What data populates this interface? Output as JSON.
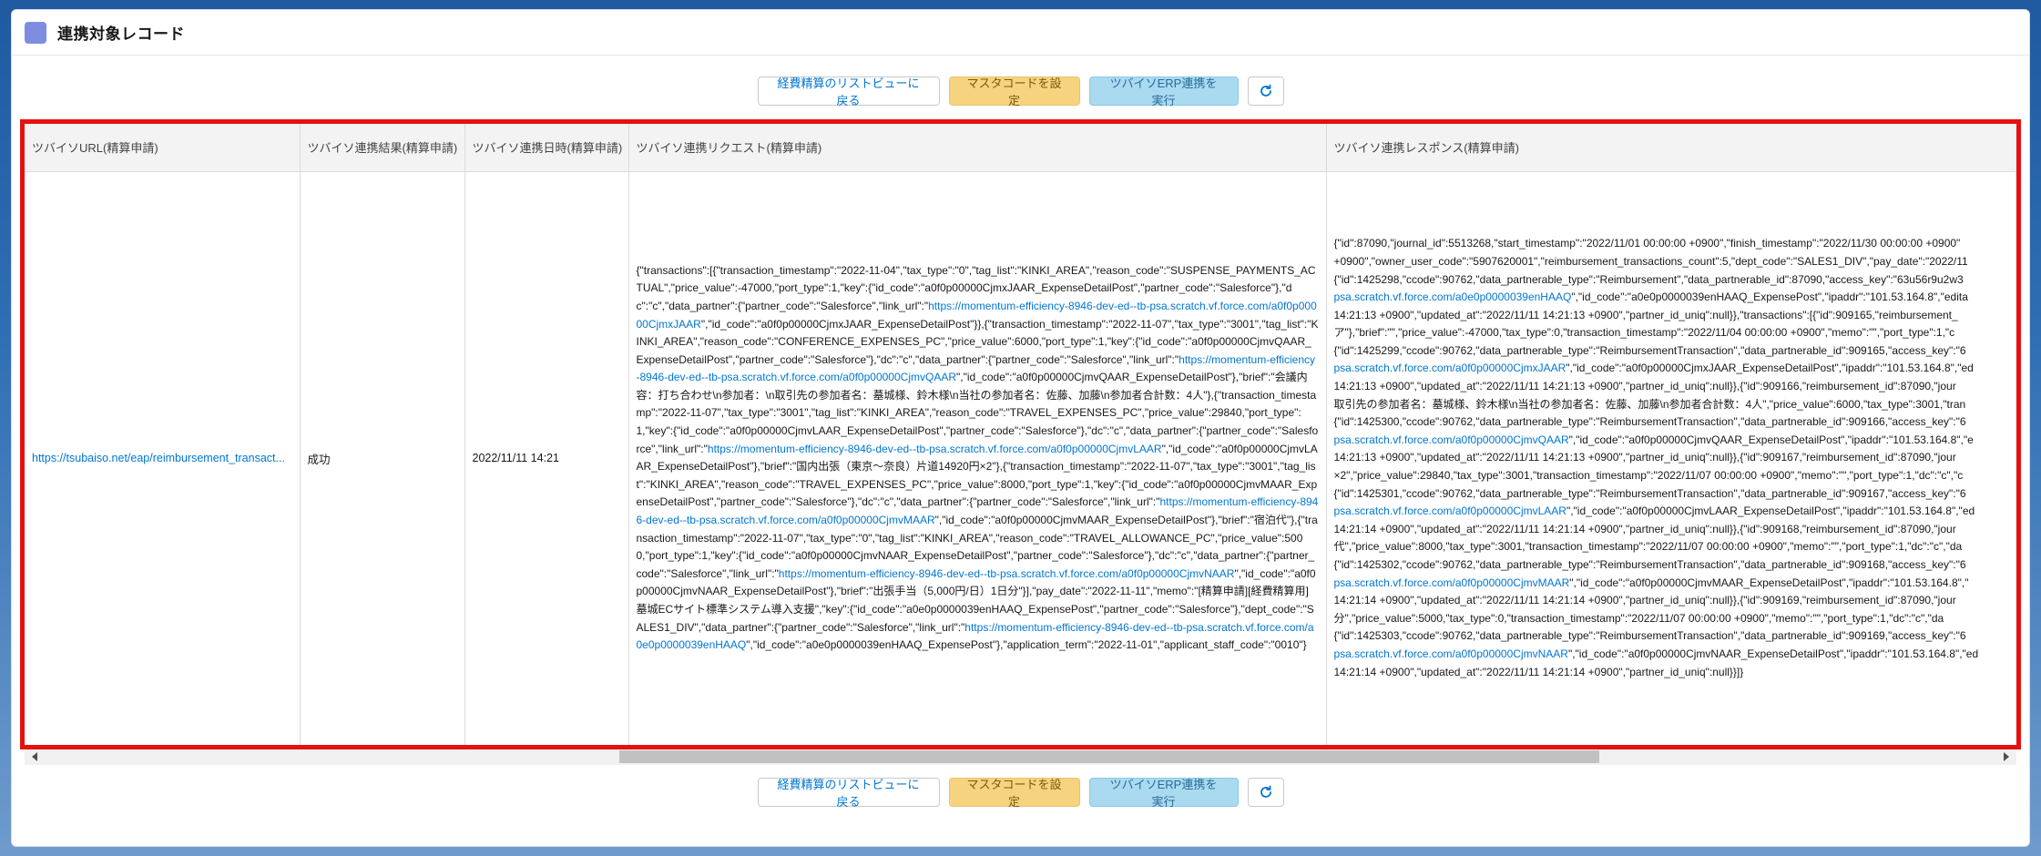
{
  "card": {
    "title": "連携対象レコード"
  },
  "toolbar": {
    "back_label": "経費精算のリストビューに戻る",
    "master_label": "マスタコードを設定",
    "erp_label": "ツバイソERP連携を実行",
    "refresh_icon": "refresh-icon"
  },
  "table": {
    "columns": [
      "ツバイソURL(精算申請)",
      "ツバイソ連携結果(精算申請)",
      "ツバイソ連携日時(精算申請)",
      "ツバイソ連携リクエスト(精算申請)",
      "ツバイソ連携レスポンス(精算申請)"
    ],
    "row": {
      "url": "https://tsubaiso.net/eap/reimbursement_transact...",
      "result": "成功",
      "datetime": "2022/11/11 14:21",
      "request": [
        {
          "t": "{\"transactions\":[{\"transaction_timestamp\":\"2022-11-04\",\"tax_type\":\"0\",\"tag_list\":\"KINKI_AREA\",\"reason_code\":\"SUSPENSE_PAYMENTS_ACTUAL\",\"price_value\":-47000,\"port_type\":1,\"key\":{\"id_code\":\"a0f0p00000CjmxJAAR_ExpenseDetailPost\",\"partner_code\":\"Salesforce\"},\"dc\":\"c\",\"data_partner\":{\"partner_code\":\"Salesforce\",\"link_url\":\"",
          "l": false
        },
        {
          "t": "https://momentum-efficiency-8946-dev-ed--tb-psa.scratch.vf.force.com/a0f0p00000CjmxJAAR",
          "l": true
        },
        {
          "t": "\",\"id_code\":\"a0f0p00000CjmxJAAR_ExpenseDetailPost\"}},{\"transaction_timestamp\":\"2022-11-07\",\"tax_type\":\"3001\",\"tag_list\":\"KINKI_AREA\",\"reason_code\":\"CONFERENCE_EXPENSES_PC\",\"price_value\":6000,\"port_type\":1,\"key\":{\"id_code\":\"a0f0p00000CjmvQAAR_ExpenseDetailPost\",\"partner_code\":\"Salesforce\"},\"dc\":\"c\",\"data_partner\":{\"partner_code\":\"Salesforce\",\"link_url\":\"",
          "l": false
        },
        {
          "t": "https://momentum-efficiency-8946-dev-ed--tb-psa.scratch.vf.force.com/a0f0p00000CjmvQAAR",
          "l": true
        },
        {
          "t": "\",\"id_code\":\"a0f0p00000CjmvQAAR_ExpenseDetailPost\"},\"brief\":\"会議内容：打ち合わせ\\n参加者：\\n取引先の参加者名：墓城様、鈴木様\\n当社の参加者名：佐藤、加藤\\n参加者合計数：4人\"},{\"transaction_timestamp\":\"2022-11-07\",\"tax_type\":\"3001\",\"tag_list\":\"KINKI_AREA\",\"reason_code\":\"TRAVEL_EXPENSES_PC\",\"price_value\":29840,\"port_type\":1,\"key\":{\"id_code\":\"a0f0p00000CjmvLAAR_ExpenseDetailPost\",\"partner_code\":\"Salesforce\"},\"dc\":\"c\",\"data_partner\":{\"partner_code\":\"Salesforce\",\"link_url\":\"",
          "l": false
        },
        {
          "t": "https://momentum-efficiency-8946-dev-ed--tb-psa.scratch.vf.force.com/a0f0p00000CjmvLAAR",
          "l": true
        },
        {
          "t": "\",\"id_code\":\"a0f0p00000CjmvLAAR_ExpenseDetailPost\"},\"brief\":\"国内出張（東京〜奈良）片道14920円×2\"},{\"transaction_timestamp\":\"2022-11-07\",\"tax_type\":\"3001\",\"tag_list\":\"KINKI_AREA\",\"reason_code\":\"TRAVEL_EXPENSES_PC\",\"price_value\":8000,\"port_type\":1,\"key\":{\"id_code\":\"a0f0p00000CjmvMAAR_ExpenseDetailPost\",\"partner_code\":\"Salesforce\"},\"dc\":\"c\",\"data_partner\":{\"partner_code\":\"Salesforce\",\"link_url\":\"",
          "l": false
        },
        {
          "t": "https://momentum-efficiency-8946-dev-ed--tb-psa.scratch.vf.force.com/a0f0p00000CjmvMAAR",
          "l": true
        },
        {
          "t": "\",\"id_code\":\"a0f0p00000CjmvMAAR_ExpenseDetailPost\"},\"brief\":\"宿泊代\"},{\"transaction_timestamp\":\"2022-11-07\",\"tax_type\":\"0\",\"tag_list\":\"KINKI_AREA\",\"reason_code\":\"TRAVEL_ALLOWANCE_PC\",\"price_value\":5000,\"port_type\":1,\"key\":{\"id_code\":\"a0f0p00000CjmvNAAR_ExpenseDetailPost\",\"partner_code\":\"Salesforce\"},\"dc\":\"c\",\"data_partner\":{\"partner_code\":\"Salesforce\",\"link_url\":\"",
          "l": false
        },
        {
          "t": "https://momentum-efficiency-8946-dev-ed--tb-psa.scratch.vf.force.com/a0f0p00000CjmvNAAR",
          "l": true
        },
        {
          "t": "\",\"id_code\":\"a0f0p00000CjmvNAAR_ExpenseDetailPost\"},\"brief\":\"出張手当（5,000円/日）1日分\"}],\"pay_date\":\"2022-11-11\",\"memo\":\"[精算申請][経費精算用]墓城ECサイト標準システム導入支援\",\"key\":{\"id_code\":\"a0e0p0000039enHAAQ_ExpensePost\",\"partner_code\":\"Salesforce\"},\"dept_code\":\"SALES1_DIV\",\"data_partner\":{\"partner_code\":\"Salesforce\",\"link_url\":\"",
          "l": false
        },
        {
          "t": "https://momentum-efficiency-8946-dev-ed--tb-psa.scratch.vf.force.com/a0e0p0000039enHAAQ",
          "l": true
        },
        {
          "t": "\",\"id_code\":\"a0e0p0000039enHAAQ_ExpensePost\"},\"application_term\":\"2022-11-01\",\"applicant_staff_code\":\"0010\"}",
          "l": false
        }
      ],
      "response": [
        [
          {
            "t": "{\"id\":87090,\"journal_id\":5513268,\"start_timestamp\":\"2022/11/01 00:00:00 +0900\",\"finish_timestamp\":\"2022/11/30 00:00:00 +0900\"",
            "l": false
          }
        ],
        [
          {
            "t": "+0900\",\"owner_user_code\":\"5907620001\",\"reimbursement_transactions_count\":5,\"dept_code\":\"SALES1_DIV\",\"pay_date\":\"2022/11",
            "l": false
          }
        ],
        [
          {
            "t": "{\"id\":1425298,\"ccode\":90762,\"data_partnerable_type\":\"Reimbursement\",\"data_partnerable_id\":87090,\"access_key\":\"63u56r9u2w3",
            "l": false
          }
        ],
        [
          {
            "t": "psa.scratch.vf.force.com/a0e0p0000039enHAAQ",
            "l": true
          },
          {
            "t": "\",\"id_code\":\"a0e0p0000039enHAAQ_ExpensePost\",\"ipaddr\":\"101.53.164.8\",\"edita",
            "l": false
          }
        ],
        [
          {
            "t": "14:21:13 +0900\",\"updated_at\":\"2022/11/11 14:21:13 +0900\",\"partner_id_uniq\":null}},\"transactions\":[{\"id\":909165,\"reimbursement_",
            "l": false
          }
        ],
        [
          {
            "t": "ア\"},\"brief\":\"\",\"price_value\":-47000,\"tax_type\":0,\"transaction_timestamp\":\"2022/11/04 00:00:00 +0900\",\"memo\":\"\",\"port_type\":1,\"c",
            "l": false
          }
        ],
        [
          {
            "t": "{\"id\":1425299,\"ccode\":90762,\"data_partnerable_type\":\"ReimbursementTransaction\",\"data_partnerable_id\":909165,\"access_key\":\"6",
            "l": false
          }
        ],
        [
          {
            "t": "psa.scratch.vf.force.com/a0f0p00000CjmxJAAR",
            "l": true
          },
          {
            "t": "\",\"id_code\":\"a0f0p00000CjmxJAAR_ExpenseDetailPost\",\"ipaddr\":\"101.53.164.8\",\"ed",
            "l": false
          }
        ],
        [
          {
            "t": "14:21:13 +0900\",\"updated_at\":\"2022/11/11 14:21:13 +0900\",\"partner_id_uniq\":null}},{\"id\":909166,\"reimbursement_id\":87090,\"jour",
            "l": false
          }
        ],
        [
          {
            "t": "取引先の参加者名：墓城様、鈴木様\\n当社の参加者名：佐藤、加藤\\n参加者合計数：4人\",\"price_value\":6000,\"tax_type\":3001,\"tran",
            "l": false
          }
        ],
        [
          {
            "t": "{\"id\":1425300,\"ccode\":90762,\"data_partnerable_type\":\"ReimbursementTransaction\",\"data_partnerable_id\":909166,\"access_key\":\"6",
            "l": false
          }
        ],
        [
          {
            "t": "psa.scratch.vf.force.com/a0f0p00000CjmvQAAR",
            "l": true
          },
          {
            "t": "\",\"id_code\":\"a0f0p00000CjmvQAAR_ExpenseDetailPost\",\"ipaddr\":\"101.53.164.8\",\"e",
            "l": false
          }
        ],
        [
          {
            "t": "14:21:13 +0900\",\"updated_at\":\"2022/11/11 14:21:13 +0900\",\"partner_id_uniq\":null}},{\"id\":909167,\"reimbursement_id\":87090,\"jour",
            "l": false
          }
        ],
        [
          {
            "t": "×2\",\"price_value\":29840,\"tax_type\":3001,\"transaction_timestamp\":\"2022/11/07 00:00:00 +0900\",\"memo\":\"\",\"port_type\":1,\"dc\":\"c\",\"c",
            "l": false
          }
        ],
        [
          {
            "t": "{\"id\":1425301,\"ccode\":90762,\"data_partnerable_type\":\"ReimbursementTransaction\",\"data_partnerable_id\":909167,\"access_key\":\"6",
            "l": false
          }
        ],
        [
          {
            "t": "psa.scratch.vf.force.com/a0f0p00000CjmvLAAR",
            "l": true
          },
          {
            "t": "\",\"id_code\":\"a0f0p00000CjmvLAAR_ExpenseDetailPost\",\"ipaddr\":\"101.53.164.8\",\"ed",
            "l": false
          }
        ],
        [
          {
            "t": "14:21:14 +0900\",\"updated_at\":\"2022/11/11 14:21:14 +0900\",\"partner_id_uniq\":null}},{\"id\":909168,\"reimbursement_id\":87090,\"jour",
            "l": false
          }
        ],
        [
          {
            "t": "代\",\"price_value\":8000,\"tax_type\":3001,\"transaction_timestamp\":\"2022/11/07 00:00:00 +0900\",\"memo\":\"\",\"port_type\":1,\"dc\":\"c\",\"da",
            "l": false
          }
        ],
        [
          {
            "t": "{\"id\":1425302,\"ccode\":90762,\"data_partnerable_type\":\"ReimbursementTransaction\",\"data_partnerable_id\":909168,\"access_key\":\"6",
            "l": false
          }
        ],
        [
          {
            "t": "psa.scratch.vf.force.com/a0f0p00000CjmvMAAR",
            "l": true
          },
          {
            "t": "\",\"id_code\":\"a0f0p00000CjmvMAAR_ExpenseDetailPost\",\"ipaddr\":\"101.53.164.8\",\"",
            "l": false
          }
        ],
        [
          {
            "t": "14:21:14 +0900\",\"updated_at\":\"2022/11/11 14:21:14 +0900\",\"partner_id_uniq\":null}},{\"id\":909169,\"reimbursement_id\":87090,\"jour",
            "l": false
          }
        ],
        [
          {
            "t": "分\",\"price_value\":5000,\"tax_type\":0,\"transaction_timestamp\":\"2022/11/07 00:00:00 +0900\",\"memo\":\"\",\"port_type\":1,\"dc\":\"c\",\"da",
            "l": false
          }
        ],
        [
          {
            "t": "{\"id\":1425303,\"ccode\":90762,\"data_partnerable_type\":\"ReimbursementTransaction\",\"data_partnerable_id\":909169,\"access_key\":\"6",
            "l": false
          }
        ],
        [
          {
            "t": "psa.scratch.vf.force.com/a0f0p00000CjmvNAAR",
            "l": true
          },
          {
            "t": "\",\"id_code\":\"a0f0p00000CjmvNAAR_ExpenseDetailPost\",\"ipaddr\":\"101.53.164.8\",\"ed",
            "l": false
          }
        ],
        [
          {
            "t": "14:21:14 +0900\",\"updated_at\":\"2022/11/11 14:21:14 +0900\",\"partner_id_uniq\":null}}]}",
            "l": false
          }
        ]
      ]
    }
  },
  "colors": {
    "highlight": "#e5110f",
    "link": "#0176d3",
    "header_icon": "#7f8de1"
  },
  "scroll": {
    "thumb_fraction": 0.49
  }
}
